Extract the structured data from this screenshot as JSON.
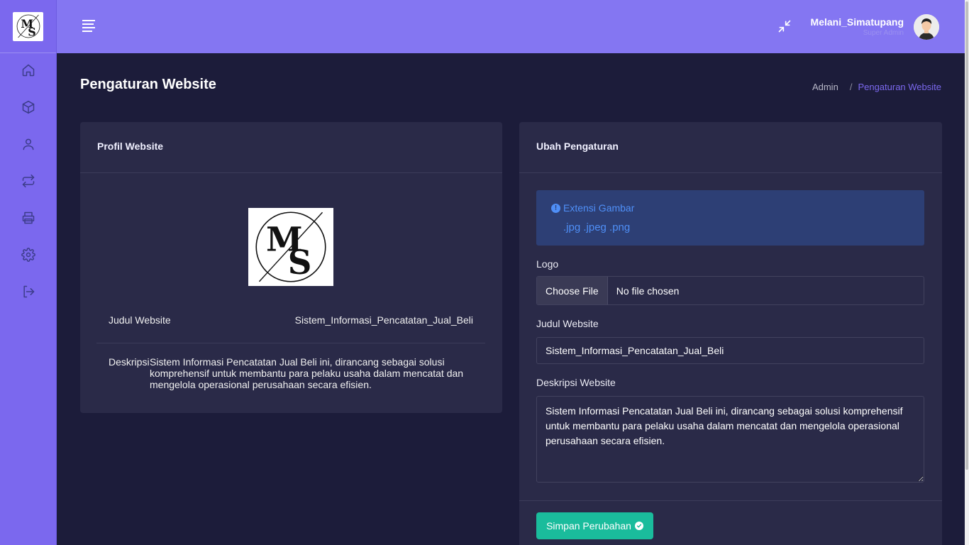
{
  "sidebar": {
    "items": [
      {
        "icon": "home-icon"
      },
      {
        "icon": "box-icon"
      },
      {
        "icon": "user-icon"
      },
      {
        "icon": "transfer-icon"
      },
      {
        "icon": "printer-icon"
      },
      {
        "icon": "gear-icon"
      },
      {
        "icon": "logout-icon"
      }
    ]
  },
  "topbar": {
    "user_name": "Melani_Simatupang",
    "user_role": "Super Admin"
  },
  "page": {
    "title": "Pengaturan Website",
    "breadcrumb": [
      "Admin",
      "/",
      "Pengaturan Website"
    ]
  },
  "profile_card": {
    "header": "Profil Website",
    "title_label": "Judul Website",
    "title_value": "Sistem_Informasi_Pencatatan_Jual_Beli",
    "desc_label": "Deskripsi",
    "desc_value": "Sistem Informasi Pencatatan Jual Beli ini, dirancang sebagai solusi komprehensif untuk membantu para pelaku usaha dalam mencatat dan mengelola operasional perusahaan secara efisien."
  },
  "settings_card": {
    "header": "Ubah Pengaturan",
    "alert_title": "Extensi Gambar",
    "alert_extensions": ".jpg .jpeg .png",
    "logo_label": "Logo",
    "file_button": "Choose File",
    "file_status": "No file chosen",
    "title_label": "Judul Website",
    "title_value": "Sistem_Informasi_Pencatatan_Jual_Beli",
    "desc_label": "Deskripsi Website",
    "desc_value": "Sistem Informasi Pencatatan Jual Beli ini, dirancang sebagai solusi komprehensif untuk membantu para pelaku usaha dalam mencatat dan mengelola operasional perusahaan secara efisien.",
    "save_label": "Simpan Perubahan"
  },
  "colors": {
    "sidebar": "#7b68ee",
    "topbar": "#8476f2",
    "background": "#1c1c3a",
    "card": "#2a2a48",
    "accent": "#1abc9c",
    "alert": "#2d3f75"
  }
}
